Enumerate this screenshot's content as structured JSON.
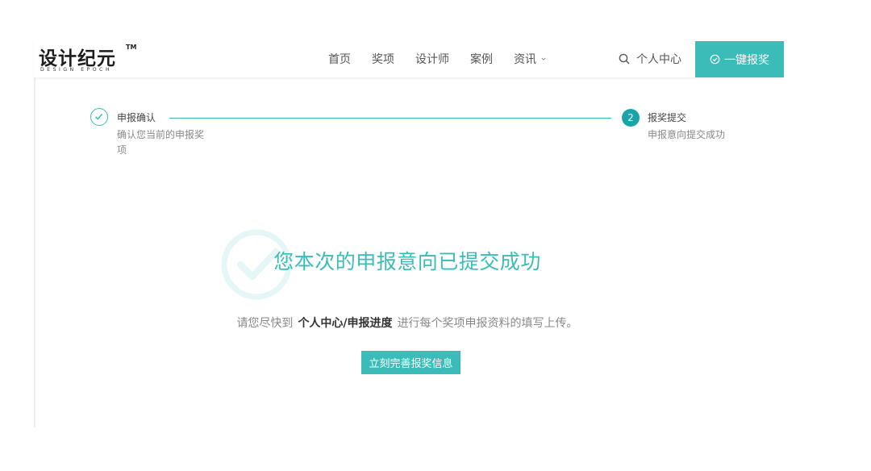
{
  "logo": {
    "main": "设计纪元",
    "tm": "TM",
    "sub": "DESIGN EPOCH"
  },
  "nav": {
    "items": [
      {
        "label": "首页"
      },
      {
        "label": "奖项"
      },
      {
        "label": "设计师"
      },
      {
        "label": "案例"
      },
      {
        "label": "资讯"
      }
    ],
    "user_center": "个人中心",
    "cta_label": "一键报奖"
  },
  "steps": [
    {
      "title": "申报确认",
      "desc": "确认您当前的申报奖项",
      "state": "completed"
    },
    {
      "number": "2",
      "title": "报奖提交",
      "desc": "申报意向提交成功",
      "state": "active"
    }
  ],
  "success": {
    "title": "您本次的申报意向已提交成功",
    "hint_before": "请您尽快到",
    "hint_strong": "个人中心/申报进度",
    "hint_after": "进行每个奖项申报资料的填写上传。",
    "button_label": "立刻完善报奖信息"
  },
  "colors": {
    "accent": "#3bbcb8",
    "accent_dark": "#18a5a7"
  }
}
